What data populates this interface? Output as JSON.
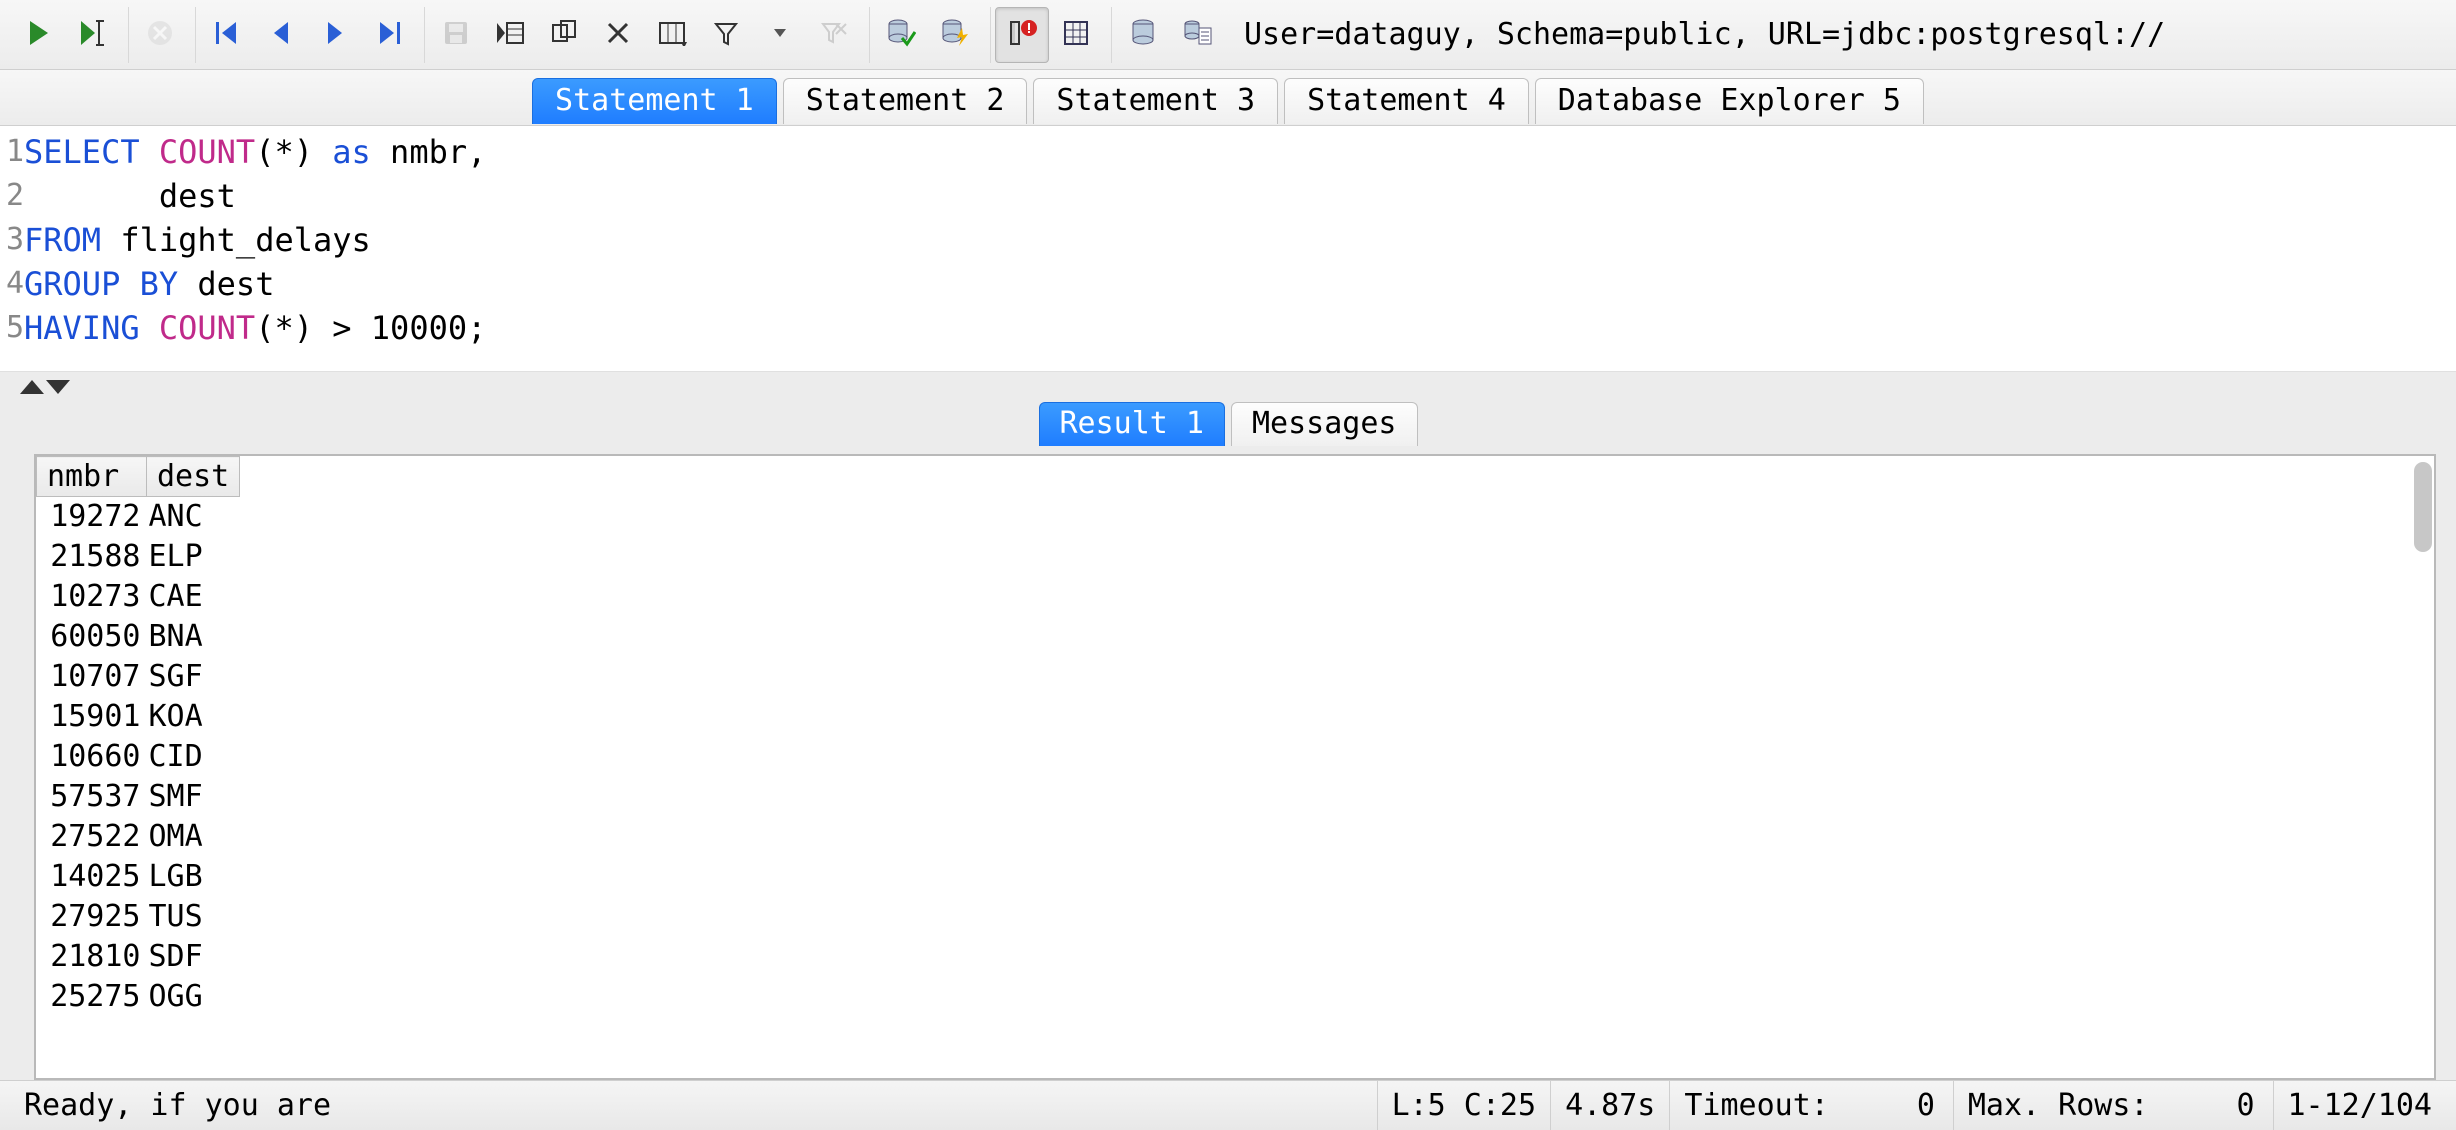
{
  "toolbar": {
    "conn_info": "User=dataguy, Schema=public, URL=jdbc:postgresql://"
  },
  "tabs": [
    {
      "label": "Statement 1",
      "active": true
    },
    {
      "label": "Statement 2",
      "active": false
    },
    {
      "label": "Statement 3",
      "active": false
    },
    {
      "label": "Statement 4",
      "active": false
    },
    {
      "label": "Database Explorer 5",
      "active": false
    }
  ],
  "sql": {
    "lines": [
      {
        "n": "1",
        "tokens": [
          [
            "kw",
            "SELECT"
          ],
          [
            "sp",
            " "
          ],
          [
            "fn",
            "COUNT"
          ],
          [
            "op",
            "("
          ],
          [
            "id",
            "*"
          ],
          [
            "op",
            ")"
          ],
          [
            "sp",
            " "
          ],
          [
            "kw",
            "as"
          ],
          [
            "sp",
            " "
          ],
          [
            "id",
            "nmbr"
          ],
          [
            "op",
            ","
          ]
        ]
      },
      {
        "n": "2",
        "tokens": [
          [
            "sp",
            "       "
          ],
          [
            "id",
            "dest"
          ]
        ]
      },
      {
        "n": "3",
        "tokens": [
          [
            "kw",
            "FROM"
          ],
          [
            "sp",
            " "
          ],
          [
            "id",
            "flight_delays"
          ]
        ]
      },
      {
        "n": "4",
        "tokens": [
          [
            "kw",
            "GROUP BY"
          ],
          [
            "sp",
            " "
          ],
          [
            "id",
            "dest"
          ]
        ]
      },
      {
        "n": "5",
        "tokens": [
          [
            "kw",
            "HAVING"
          ],
          [
            "sp",
            " "
          ],
          [
            "fn",
            "COUNT"
          ],
          [
            "op",
            "("
          ],
          [
            "id",
            "*"
          ],
          [
            "op",
            ")"
          ],
          [
            "sp",
            " "
          ],
          [
            "op",
            ">"
          ],
          [
            "sp",
            " "
          ],
          [
            "id",
            "10000"
          ],
          [
            "op",
            ";"
          ]
        ]
      }
    ]
  },
  "result_tabs": [
    {
      "label": "Result 1",
      "active": true
    },
    {
      "label": "Messages",
      "active": false
    }
  ],
  "result": {
    "columns": [
      "nmbr",
      "dest"
    ],
    "rows": [
      {
        "nmbr": "19272",
        "dest": "ANC"
      },
      {
        "nmbr": "21588",
        "dest": "ELP"
      },
      {
        "nmbr": "10273",
        "dest": "CAE"
      },
      {
        "nmbr": "60050",
        "dest": "BNA"
      },
      {
        "nmbr": "10707",
        "dest": "SGF"
      },
      {
        "nmbr": "15901",
        "dest": "KOA"
      },
      {
        "nmbr": "10660",
        "dest": "CID"
      },
      {
        "nmbr": "57537",
        "dest": "SMF"
      },
      {
        "nmbr": "27522",
        "dest": "OMA"
      },
      {
        "nmbr": "14025",
        "dest": "LGB"
      },
      {
        "nmbr": "27925",
        "dest": "TUS"
      },
      {
        "nmbr": "21810",
        "dest": "SDF"
      },
      {
        "nmbr": "25275",
        "dest": "OGG"
      }
    ]
  },
  "status": {
    "ready": "Ready, if you are",
    "cursor": "L:5 C:25",
    "elapsed": "4.87s",
    "timeout_label": "Timeout:",
    "timeout_value": "0",
    "maxrows_label": "Max. Rows:",
    "maxrows_value": "0",
    "range": "1-12/104"
  }
}
